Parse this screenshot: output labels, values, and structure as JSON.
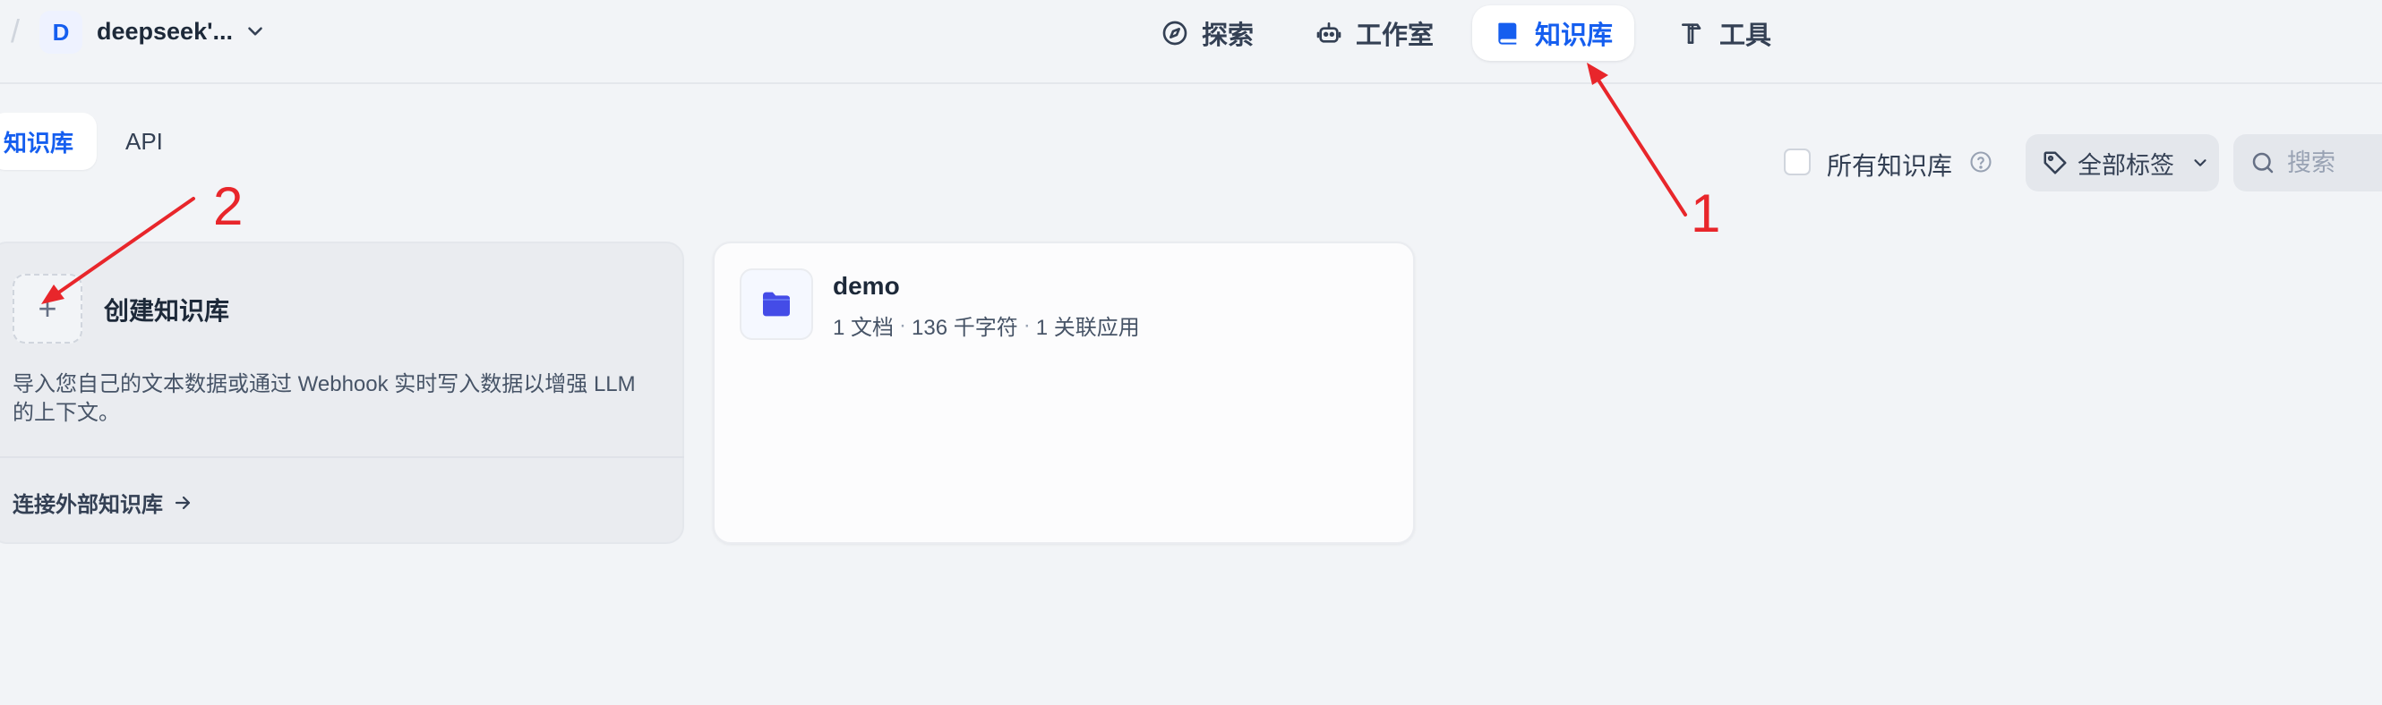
{
  "header": {
    "workspace": {
      "avatar_letter": "D",
      "name": "deepseek'..."
    },
    "nav": [
      {
        "label": "探索",
        "icon": "compass-icon"
      },
      {
        "label": "工作室",
        "icon": "robot-icon"
      },
      {
        "label": "知识库",
        "icon": "book-icon",
        "active": true
      },
      {
        "label": "工具",
        "icon": "hammer-icon"
      }
    ]
  },
  "tabs": [
    {
      "label": "知识库",
      "active": true
    },
    {
      "label": "API"
    }
  ],
  "filters": {
    "all_kb_label": "所有知识库",
    "tag_label": "全部标签",
    "search_placeholder": "搜索"
  },
  "create_card": {
    "plus": "+",
    "title": "创建知识库",
    "description": "导入您自己的文本数据或通过 Webhook 实时写入数据以增强 LLM 的上下文。",
    "external_link": "连接外部知识库"
  },
  "knowledge_bases": [
    {
      "name": "demo",
      "docs": "1 文档",
      "chars": "136 千字符",
      "apps": "1 关联应用"
    }
  ],
  "annotations": {
    "label_1": "1",
    "label_2": "2",
    "color": "#e8262b"
  },
  "colors": {
    "accent": "#155eef",
    "background": "#f2f4f7",
    "folder": "#444ce7"
  }
}
